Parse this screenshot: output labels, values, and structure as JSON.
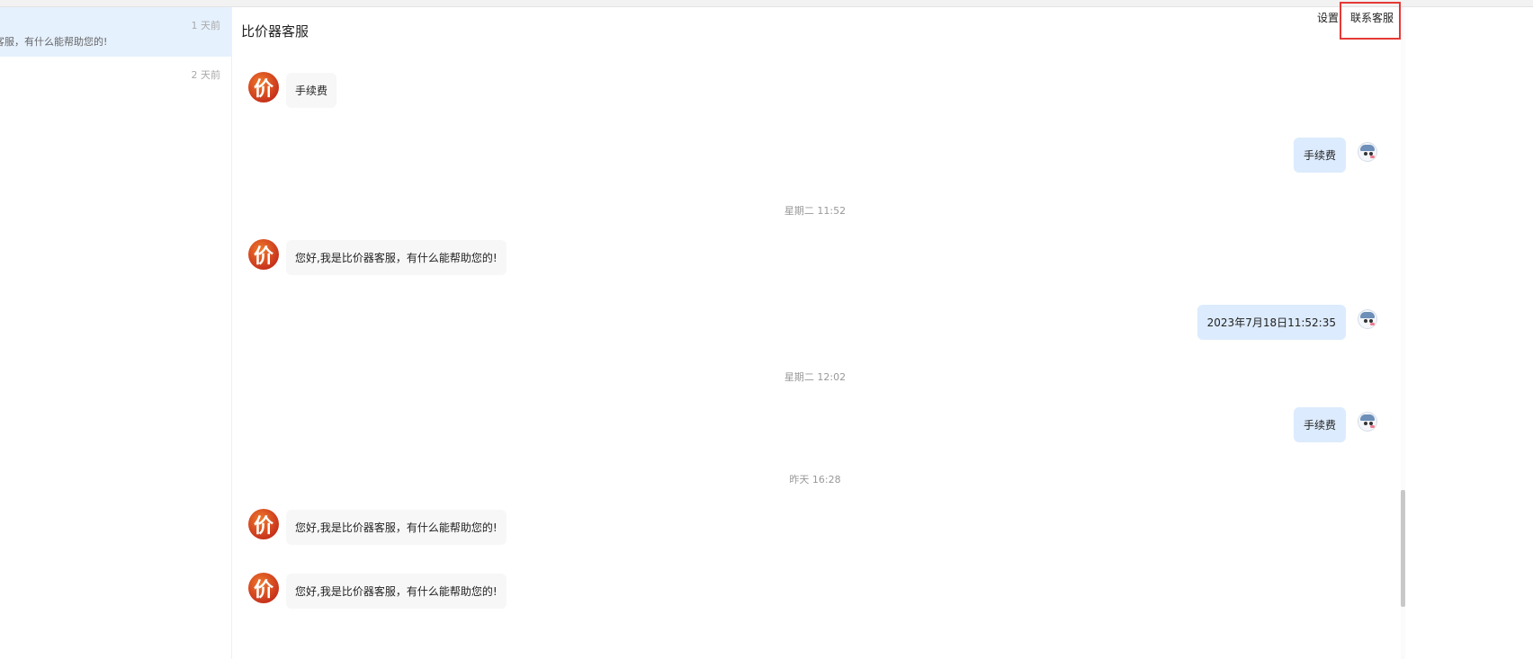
{
  "sidebar": {
    "conversations": [
      {
        "time": "1 天前",
        "preview": "客服，有什么能帮助您的!"
      },
      {
        "time": "2 天前",
        "preview": ""
      }
    ]
  },
  "header": {
    "title": "比价器客服",
    "settings_label": "设置",
    "contact_label": "联系客服"
  },
  "bot_avatar_char": "价",
  "messages": [
    {
      "from": "bot",
      "text": "手续费"
    },
    {
      "from": "user",
      "text": "手续费"
    },
    {
      "timestamp": "星期二 11:52"
    },
    {
      "from": "bot",
      "text": "您好,我是比价器客服，有什么能帮助您的!"
    },
    {
      "from": "user",
      "text": "2023年7月18日11:52:35"
    },
    {
      "timestamp": "星期二 12:02"
    },
    {
      "from": "user",
      "text": "手续费"
    },
    {
      "timestamp": "昨天 16:28"
    },
    {
      "from": "bot",
      "text": "您好,我是比价器客服，有什么能帮助您的!"
    },
    {
      "from": "bot",
      "text": "您好,我是比价器客服，有什么能帮助您的!"
    }
  ],
  "colors": {
    "active_conversation": "#e6f1fe",
    "user_bubble": "#dcebfd",
    "bot_bubble": "#f7f7f7",
    "highlight_box": "#e53935",
    "bot_avatar": "#d9471f"
  },
  "icons": {
    "bot_avatar": "price-logo-icon",
    "user_avatar": "user-avatar-icon"
  }
}
